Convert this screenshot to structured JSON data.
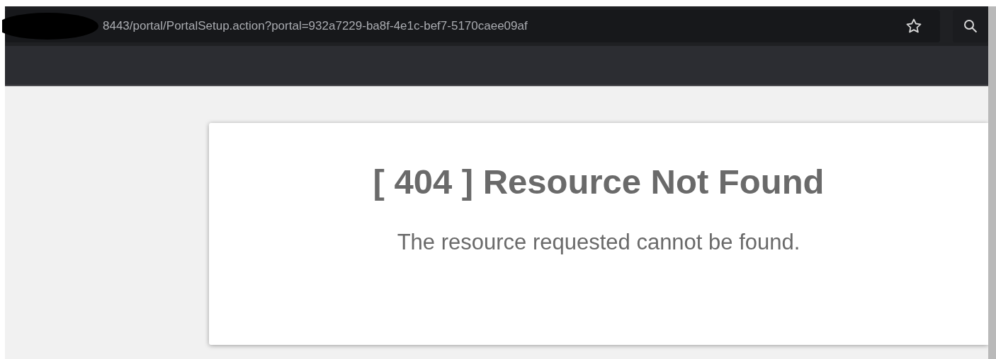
{
  "address_bar": {
    "url": "8443/portal/PortalSetup.action?portal=932a7229-ba8f-4e1c-bef7-5170caee09af"
  },
  "error": {
    "title": "[ 404 ] Resource Not Found",
    "message": "The resource requested cannot be found."
  }
}
